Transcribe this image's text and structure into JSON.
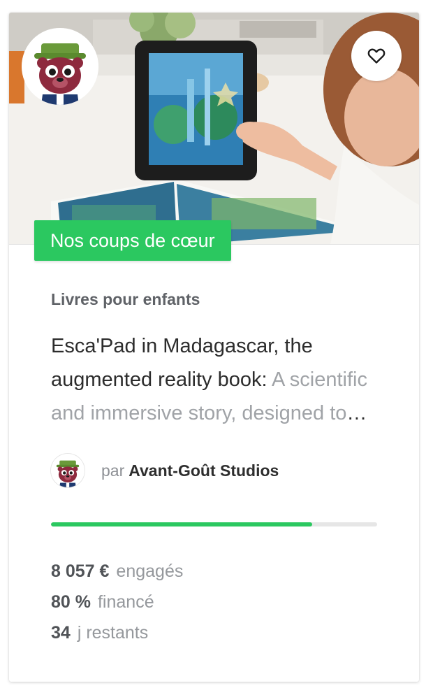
{
  "card": {
    "badge": "Nos coups de cœur",
    "category": "Livres pour enfants",
    "title": "Esca'Pad in Madagascar, the augmented reality book:",
    "subtitle": "A scientific and immersive story, designed to make children discover the biodiversity of Madagascar",
    "owner": {
      "prefix": "par",
      "name": "Avant-Goût Studios"
    },
    "progress_fraction": 0.8,
    "stats": [
      {
        "value": "8 057 €",
        "label": "engagés"
      },
      {
        "value": "80 %",
        "label": "financé"
      },
      {
        "value": "34",
        "label": "j restants"
      }
    ],
    "icons": {
      "favorite": "heart-outline-icon",
      "avatar": "bear-mascot-avatar"
    }
  },
  "colors": {
    "accent_green": "#2bc860",
    "title_text": "#2c2c2c",
    "muted_text": "#a0a3a7",
    "category_text": "#5f6267"
  }
}
